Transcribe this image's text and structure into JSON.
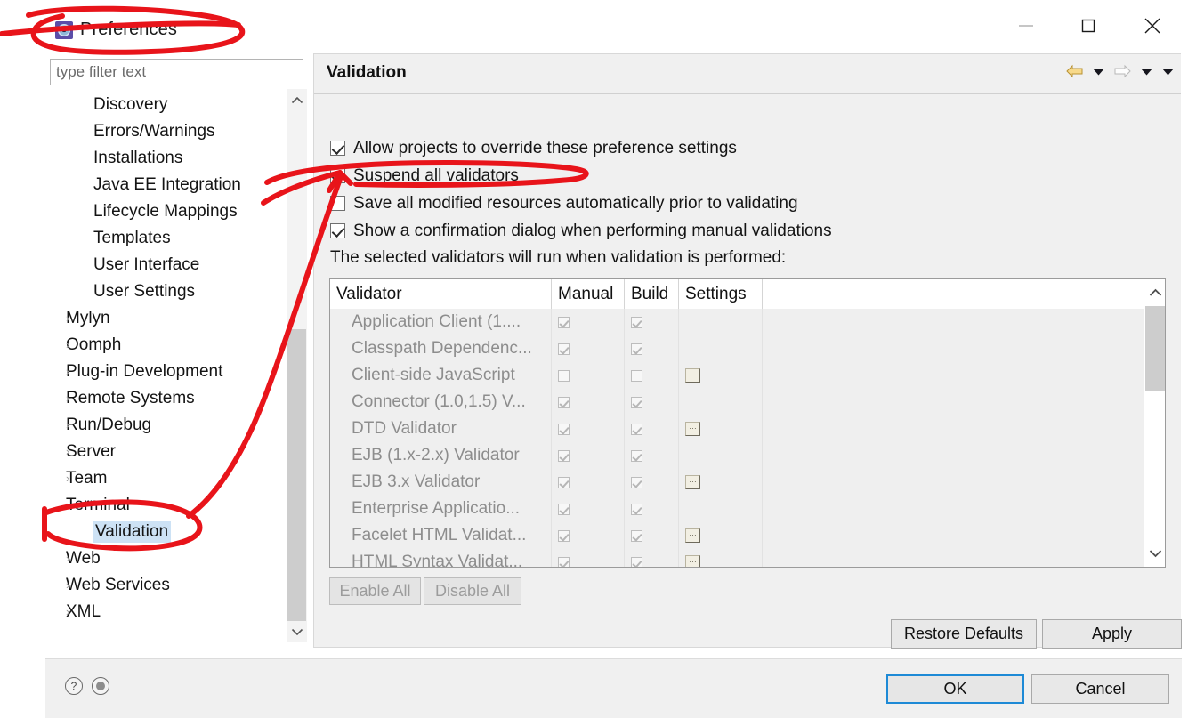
{
  "window": {
    "title": "Preferences",
    "icon": "gear-icon",
    "controls": {
      "minimize": "minimize-icon",
      "maximize": "maximize-icon",
      "close": "close-icon"
    }
  },
  "sidebar": {
    "filter_placeholder": "type filter text",
    "items": [
      {
        "label": "Discovery",
        "expandable": false,
        "selected": false
      },
      {
        "label": "Errors/Warnings",
        "expandable": false,
        "selected": false
      },
      {
        "label": "Installations",
        "expandable": false,
        "selected": false
      },
      {
        "label": "Java EE Integration",
        "expandable": false,
        "selected": false
      },
      {
        "label": "Lifecycle Mappings",
        "expandable": false,
        "selected": false
      },
      {
        "label": "Templates",
        "expandable": false,
        "selected": false
      },
      {
        "label": "User Interface",
        "expandable": false,
        "selected": false
      },
      {
        "label": "User Settings",
        "expandable": false,
        "selected": false
      },
      {
        "label": "Mylyn",
        "expandable": true,
        "selected": false
      },
      {
        "label": "Oomph",
        "expandable": true,
        "selected": false
      },
      {
        "label": "Plug-in Development",
        "expandable": true,
        "selected": false
      },
      {
        "label": "Remote Systems",
        "expandable": true,
        "selected": false
      },
      {
        "label": "Run/Debug",
        "expandable": true,
        "selected": false
      },
      {
        "label": "Server",
        "expandable": true,
        "selected": false
      },
      {
        "label": "Team",
        "expandable": true,
        "selected": false
      },
      {
        "label": "Terminal",
        "expandable": true,
        "selected": false
      },
      {
        "label": "Validation",
        "expandable": false,
        "selected": true
      },
      {
        "label": "Web",
        "expandable": true,
        "selected": false
      },
      {
        "label": "Web Services",
        "expandable": true,
        "selected": false
      },
      {
        "label": "XML",
        "expandable": true,
        "selected": false
      }
    ],
    "expand_arrow": "›"
  },
  "page": {
    "title": "Validation",
    "nav": {
      "back": "back-arrow-icon",
      "back_menu": "chevron-down-icon",
      "forward": "forward-arrow-icon",
      "forward_menu": "chevron-down-icon",
      "view_menu": "chevron-down-icon"
    },
    "options": [
      {
        "label": "Allow projects to override these preference settings",
        "checked": true
      },
      {
        "label": "Suspend all validators",
        "checked": true
      },
      {
        "label": "Save all modified resources automatically prior to validating",
        "checked": false
      },
      {
        "label": "Show a confirmation dialog when performing manual validations",
        "checked": true
      }
    ],
    "hint": "The selected validators will run when validation is performed:",
    "table": {
      "columns": [
        "Validator",
        "Manual",
        "Build",
        "Settings"
      ],
      "rows": [
        {
          "validator": "Application Client (1....",
          "manual": true,
          "build": true,
          "settings": false
        },
        {
          "validator": "Classpath Dependenc...",
          "manual": true,
          "build": true,
          "settings": false
        },
        {
          "validator": "Client-side JavaScript",
          "manual": false,
          "build": false,
          "settings": true
        },
        {
          "validator": "Connector (1.0,1.5) V...",
          "manual": true,
          "build": true,
          "settings": false
        },
        {
          "validator": "DTD Validator",
          "manual": true,
          "build": true,
          "settings": true
        },
        {
          "validator": "EJB (1.x-2.x) Validator",
          "manual": true,
          "build": true,
          "settings": false
        },
        {
          "validator": "EJB 3.x Validator",
          "manual": true,
          "build": true,
          "settings": true
        },
        {
          "validator": "Enterprise Applicatio...",
          "manual": true,
          "build": true,
          "settings": false
        },
        {
          "validator": "Facelet HTML Validat...",
          "manual": true,
          "build": true,
          "settings": true
        },
        {
          "validator": "HTML Syntax Validat...",
          "manual": true,
          "build": true,
          "settings": true
        }
      ],
      "settings_button_label": "…"
    },
    "buttons": {
      "enable_all": "Enable All",
      "disable_all": "Disable All",
      "restore_defaults": "Restore Defaults",
      "apply": "Apply"
    }
  },
  "footer": {
    "help_icon": "?",
    "ok": "OK",
    "cancel": "Cancel"
  },
  "colors": {
    "selection": "#cde2f5",
    "focus_border": "#1e8ad6",
    "annotation": "#e8141a",
    "disabled_text": "#8d8d8d"
  }
}
